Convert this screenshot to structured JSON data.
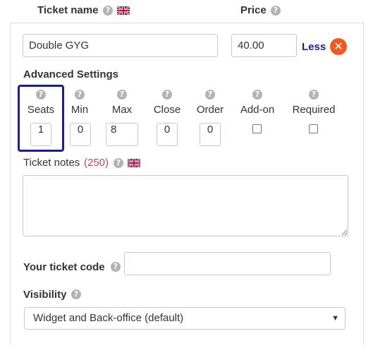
{
  "header": {
    "ticket_name_label": "Ticket name",
    "price_label": "Price",
    "help_glyph": "?"
  },
  "ticket": {
    "name_value": "Double GYG",
    "price_value": "40.00",
    "less_label": "Less",
    "remove_glyph": "✕"
  },
  "advanced": {
    "title": "Advanced Settings",
    "columns": [
      {
        "label": "Seats",
        "value": "1"
      },
      {
        "label": "Min",
        "value": "0"
      },
      {
        "label": "Max",
        "value": "8"
      },
      {
        "label": "Close",
        "value": "0"
      },
      {
        "label": "Order",
        "value": "0"
      },
      {
        "label": "Add-on",
        "checked": false
      },
      {
        "label": "Required",
        "checked": false
      }
    ]
  },
  "notes": {
    "label": "Ticket notes",
    "counter": "(250)",
    "value": ""
  },
  "ticket_code": {
    "label": "Your ticket code",
    "value": ""
  },
  "visibility": {
    "label": "Visibility",
    "selected": "Widget and Back-office (default)"
  },
  "colors": {
    "highlight_border": "#1b1f8a",
    "less_link": "#1a1aaa",
    "remove_button": "#f05a24",
    "counter_text": "#b94a48"
  },
  "icons": [
    "help-icon",
    "uk-flag-icon",
    "remove-icon",
    "chevron-down-icon"
  ]
}
